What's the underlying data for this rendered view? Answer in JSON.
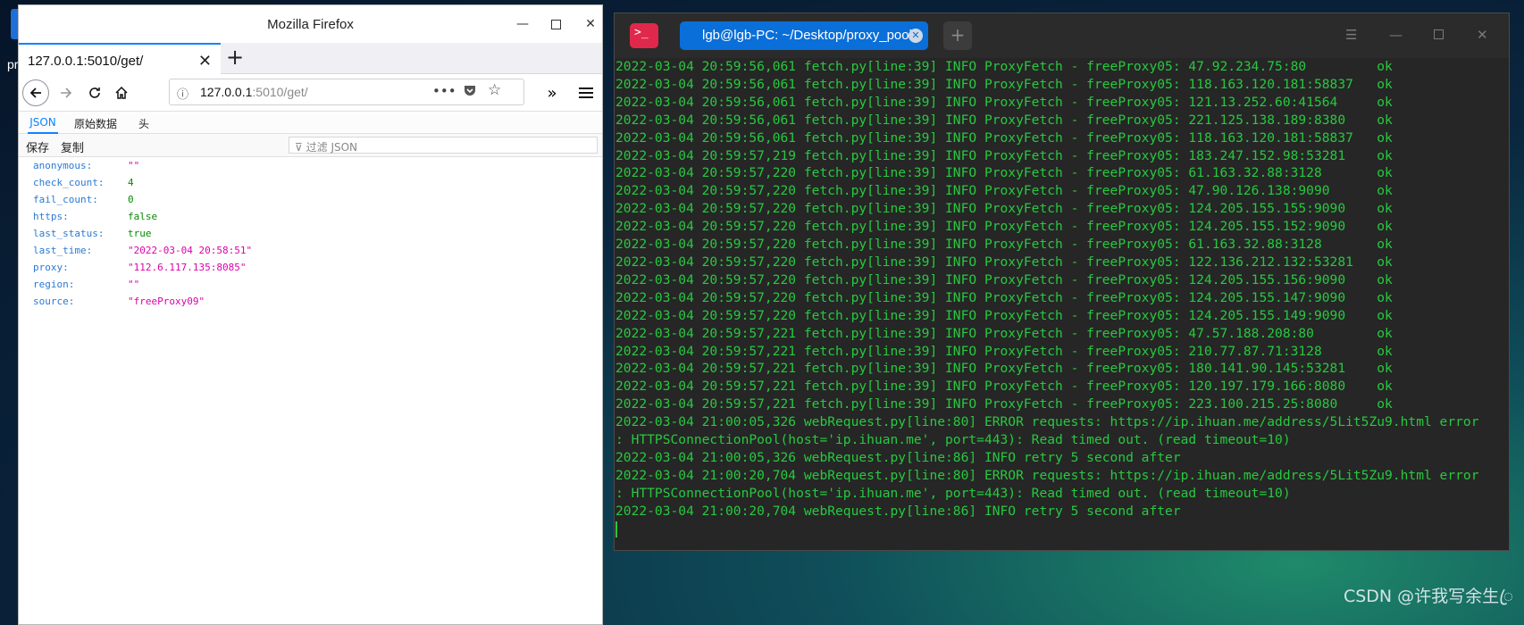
{
  "desktop": {
    "icon_label": "pr",
    "watermark": "CSDN @许我写余生ꦿ"
  },
  "firefox": {
    "window_title": "Mozilla Firefox",
    "tab_title": "127.0.0.1:5010/get/",
    "url_host": "127.0.0.1",
    "url_path": ":5010/get/",
    "viewer_tabs": [
      "JSON",
      "原始数据",
      "头"
    ],
    "tools": {
      "save": "保存",
      "copy": "复制",
      "filter_placeholder": "过滤 JSON"
    },
    "json": [
      {
        "key": "anonymous:",
        "value": "\"\"",
        "type": "str"
      },
      {
        "key": "check_count:",
        "value": "4",
        "type": "num"
      },
      {
        "key": "fail_count:",
        "value": "0",
        "type": "num"
      },
      {
        "key": "https:",
        "value": "false",
        "type": "bool"
      },
      {
        "key": "last_status:",
        "value": "true",
        "type": "bool"
      },
      {
        "key": "last_time:",
        "value": "\"2022-03-04 20:58:51\"",
        "type": "str"
      },
      {
        "key": "proxy:",
        "value": "\"112.6.117.135:8085\"",
        "type": "str"
      },
      {
        "key": "region:",
        "value": "\"\"",
        "type": "str"
      },
      {
        "key": "source:",
        "value": "\"freeProxy09\"",
        "type": "str"
      }
    ]
  },
  "terminal": {
    "tab_title": "lgb@lgb-PC: ~/Desktop/proxy_pool",
    "lines": [
      "2022-03-04 20:59:56,061 fetch.py[line:39] INFO ProxyFetch - freeProxy05: 47.92.234.75:80         ok",
      "2022-03-04 20:59:56,061 fetch.py[line:39] INFO ProxyFetch - freeProxy05: 118.163.120.181:58837   ok",
      "2022-03-04 20:59:56,061 fetch.py[line:39] INFO ProxyFetch - freeProxy05: 121.13.252.60:41564     ok",
      "2022-03-04 20:59:56,061 fetch.py[line:39] INFO ProxyFetch - freeProxy05: 221.125.138.189:8380    ok",
      "2022-03-04 20:59:56,061 fetch.py[line:39] INFO ProxyFetch - freeProxy05: 118.163.120.181:58837   ok",
      "2022-03-04 20:59:57,219 fetch.py[line:39] INFO ProxyFetch - freeProxy05: 183.247.152.98:53281    ok",
      "2022-03-04 20:59:57,220 fetch.py[line:39] INFO ProxyFetch - freeProxy05: 61.163.32.88:3128       ok",
      "2022-03-04 20:59:57,220 fetch.py[line:39] INFO ProxyFetch - freeProxy05: 47.90.126.138:9090      ok",
      "2022-03-04 20:59:57,220 fetch.py[line:39] INFO ProxyFetch - freeProxy05: 124.205.155.155:9090    ok",
      "2022-03-04 20:59:57,220 fetch.py[line:39] INFO ProxyFetch - freeProxy05: 124.205.155.152:9090    ok",
      "2022-03-04 20:59:57,220 fetch.py[line:39] INFO ProxyFetch - freeProxy05: 61.163.32.88:3128       ok",
      "2022-03-04 20:59:57,220 fetch.py[line:39] INFO ProxyFetch - freeProxy05: 122.136.212.132:53281   ok",
      "2022-03-04 20:59:57,220 fetch.py[line:39] INFO ProxyFetch - freeProxy05: 124.205.155.156:9090    ok",
      "2022-03-04 20:59:57,220 fetch.py[line:39] INFO ProxyFetch - freeProxy05: 124.205.155.147:9090    ok",
      "2022-03-04 20:59:57,220 fetch.py[line:39] INFO ProxyFetch - freeProxy05: 124.205.155.149:9090    ok",
      "2022-03-04 20:59:57,221 fetch.py[line:39] INFO ProxyFetch - freeProxy05: 47.57.188.208:80        ok",
      "2022-03-04 20:59:57,221 fetch.py[line:39] INFO ProxyFetch - freeProxy05: 210.77.87.71:3128       ok",
      "2022-03-04 20:59:57,221 fetch.py[line:39] INFO ProxyFetch - freeProxy05: 180.141.90.145:53281    ok",
      "2022-03-04 20:59:57,221 fetch.py[line:39] INFO ProxyFetch - freeProxy05: 120.197.179.166:8080    ok",
      "2022-03-04 20:59:57,221 fetch.py[line:39] INFO ProxyFetch - freeProxy05: 223.100.215.25:8080     ok",
      "2022-03-04 21:00:05,326 webRequest.py[line:80] ERROR requests: https://ip.ihuan.me/address/5Lit5Zu9.html error",
      ": HTTPSConnectionPool(host='ip.ihuan.me', port=443): Read timed out. (read timeout=10)",
      "2022-03-04 21:00:05,326 webRequest.py[line:86] INFO retry 5 second after",
      "2022-03-04 21:00:20,704 webRequest.py[line:80] ERROR requests: https://ip.ihuan.me/address/5Lit5Zu9.html error",
      ": HTTPSConnectionPool(host='ip.ihuan.me', port=443): Read timed out. (read timeout=10)",
      "2022-03-04 21:00:20,704 webRequest.py[line:86] INFO retry 5 second after"
    ]
  }
}
